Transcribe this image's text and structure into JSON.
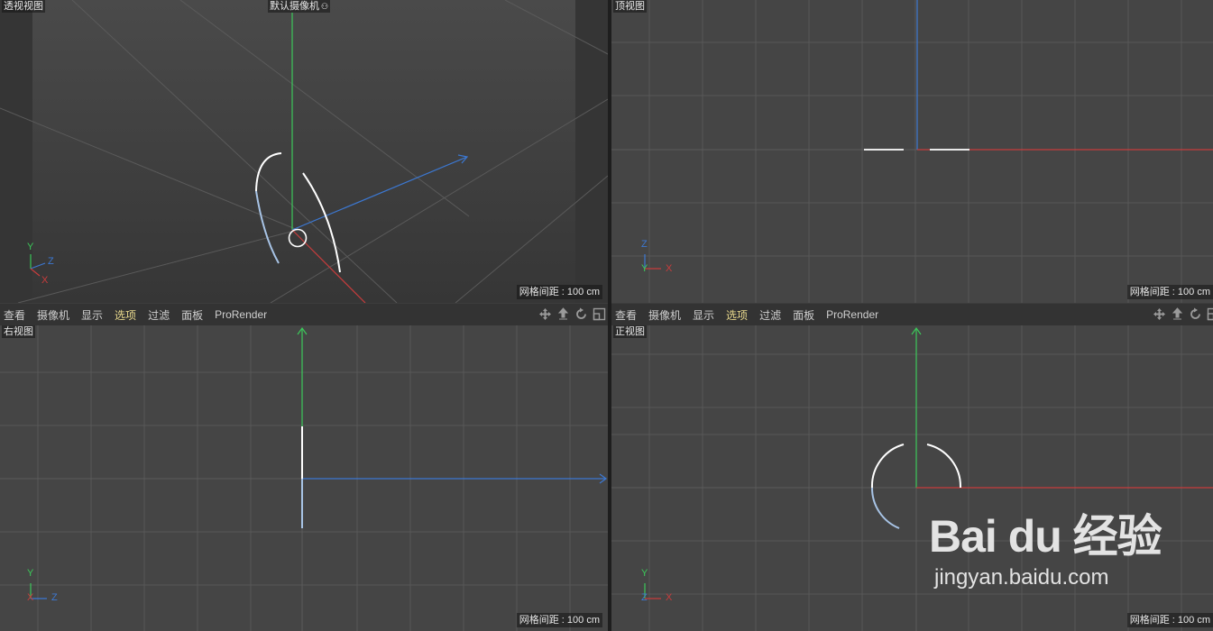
{
  "viewports": {
    "perspective": {
      "label": "透视视图",
      "camera": "默认摄像机",
      "grid_spacing": "网格间距 : 100 cm"
    },
    "top": {
      "label": "顶视图",
      "grid_spacing": "网格间距 : 100 cm"
    },
    "right": {
      "label": "右视图",
      "grid_spacing": "网格间距 : 100 cm"
    },
    "front": {
      "label": "正视图",
      "grid_spacing": "网格间距 : 100 cm"
    }
  },
  "menu": {
    "view": "查看",
    "camera": "摄像机",
    "display": "显示",
    "options": "选项",
    "filter": "过滤",
    "panel": "面板",
    "prorender": "ProRender"
  },
  "axes": {
    "x": "X",
    "y": "Y",
    "z": "Z"
  },
  "watermark": {
    "brand": "Bai du 经验",
    "url": "jingyan.baidu.com"
  },
  "colors": {
    "x_axis": "#c83c3c",
    "y_axis": "#3cc85a",
    "z_axis": "#3c78d2",
    "spline": "#ffffff",
    "active_menu": "#e8d88c"
  },
  "icons": [
    "move-view-icon",
    "pan-view-icon",
    "rotate-view-icon",
    "maximize-view-icon"
  ]
}
